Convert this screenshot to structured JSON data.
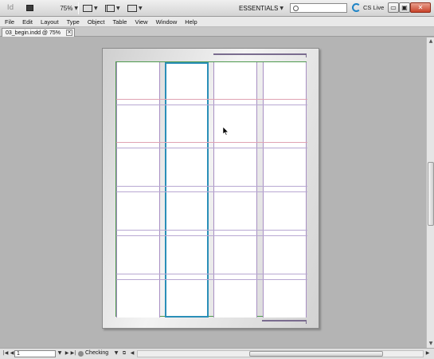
{
  "app": {
    "logo_text": "Id",
    "zoom": "75%",
    "workspace": "ESSENTIALS",
    "search_placeholder": "",
    "cs_live": "CS Live",
    "window_controls": {
      "minimize": "▭",
      "maximize": "▣",
      "close": "✕"
    }
  },
  "menu": [
    "File",
    "Edit",
    "Layout",
    "Type",
    "Object",
    "Table",
    "View",
    "Window",
    "Help"
  ],
  "document": {
    "tab_title": "03_begin.indd @ 75%",
    "close_glyph": "×"
  },
  "status": {
    "page_number": "1",
    "preflight": "Checking"
  },
  "icons": {
    "bridge": "bridge-icon",
    "view_options": "view-options-icon",
    "screen_mode": "screen-mode-icon",
    "arrange": "arrange-documents-icon",
    "search": "search-icon",
    "cs_live": "cs-live-icon",
    "cursor": "arrow-cursor-icon"
  },
  "colors": {
    "margin_guide": "#4e9a4e",
    "column_guide": "#a88fc3",
    "selected_frame": "#2a8fb8",
    "baseline_guide": "#e0a3b3",
    "close_button": "#c9432a"
  }
}
